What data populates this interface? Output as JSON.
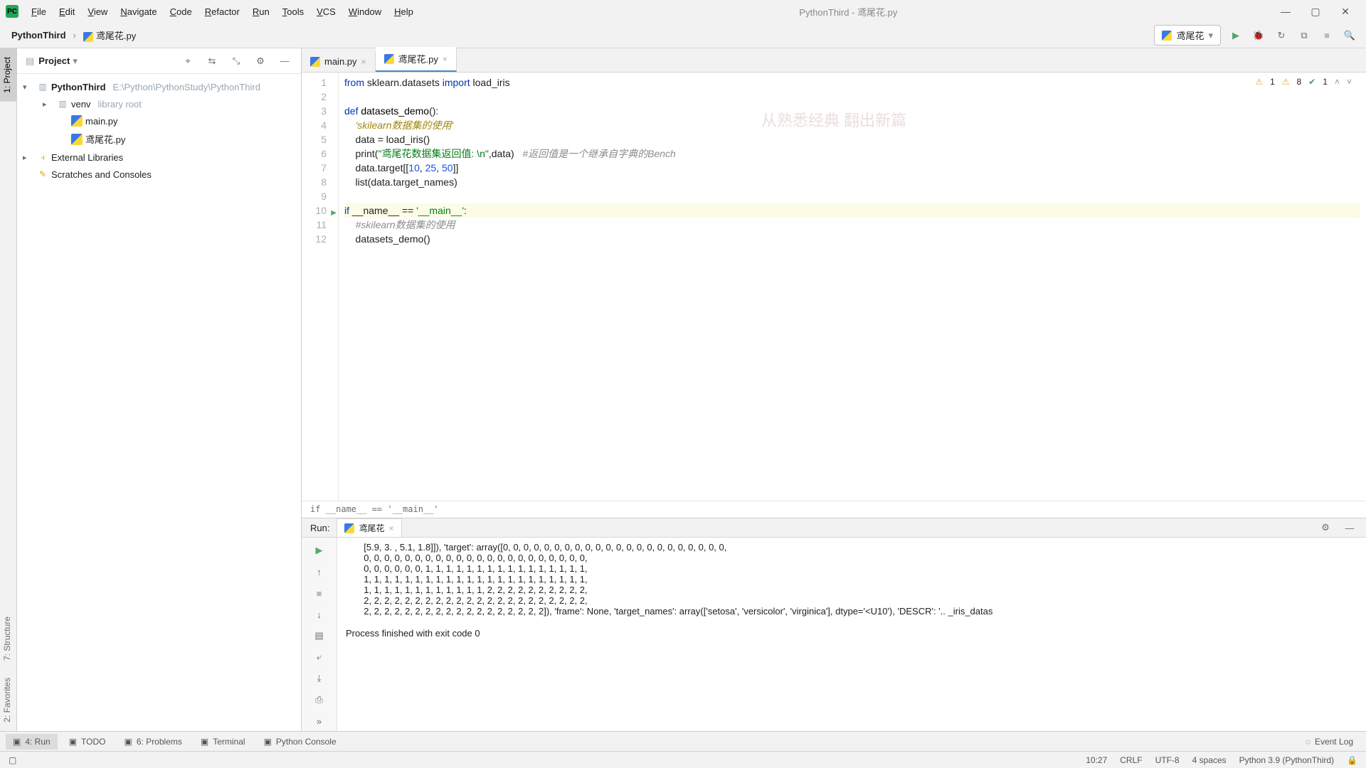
{
  "window": {
    "title": "PythonThird - 鸢尾花.py"
  },
  "menu": [
    "File",
    "Edit",
    "View",
    "Navigate",
    "Code",
    "Refactor",
    "Run",
    "Tools",
    "VCS",
    "Window",
    "Help"
  ],
  "breadcrumb": {
    "project": "PythonThird",
    "file": "鸢尾花.py"
  },
  "run_config": "鸢尾花",
  "project_panel": {
    "title": "Project",
    "root": "PythonThird",
    "root_path": "E:\\Python\\PythonStudy\\PythonThird",
    "venv": "venv",
    "venv_tag": "library root",
    "files": [
      "main.py",
      "鸢尾花.py"
    ],
    "ext_libs": "External Libraries",
    "scratches": "Scratches and Consoles"
  },
  "tabs": [
    {
      "label": "main.py",
      "active": false
    },
    {
      "label": "鸢尾花.py",
      "active": true
    }
  ],
  "inspections": {
    "warning": 1,
    "weak_warning": 8,
    "ok": 1
  },
  "watermark": "从熟悉经典  翻出新篇",
  "code": {
    "lines": [
      {
        "n": 1,
        "html": "<span class='kw'>from</span> sklearn.datasets <span class='kw'>import</span> load_iris"
      },
      {
        "n": 2,
        "html": ""
      },
      {
        "n": 3,
        "html": "<span class='kw'>def</span> <span class='fn'>datasets_demo</span>():"
      },
      {
        "n": 4,
        "html": "    <span class='deco'>'skilearn数据集的使用'</span>"
      },
      {
        "n": 5,
        "html": "    data = load_iris()"
      },
      {
        "n": 6,
        "html": "    print(<span class='str'>\"鸢尾花数据集返回值: \\n\"</span>,data)   <span class='cmt'>#返回值是一个继承自字典的Bench</span>"
      },
      {
        "n": 7,
        "html": "    data.target[[<span class='num'>10</span>, <span class='num'>25</span>, <span class='num'>50</span>]]"
      },
      {
        "n": 8,
        "html": "    list(data.target_names)"
      },
      {
        "n": 9,
        "html": ""
      },
      {
        "n": 10,
        "html": "<span class='kw'>if</span> __name__ == <span class='str'>'__main__'</span>:",
        "hl": true,
        "run": true
      },
      {
        "n": 11,
        "html": "    <span class='cmt'>#skilearn数据集的使用</span>"
      },
      {
        "n": 12,
        "html": "    datasets_demo()"
      }
    ],
    "breadcrumb": "if __name__ == '__main__'"
  },
  "run": {
    "label": "Run:",
    "tab": "鸢尾花",
    "output": [
      "       [5.9, 3. , 5.1, 1.8]]), 'target': array([0, 0, 0, 0, 0, 0, 0, 0, 0, 0, 0, 0, 0, 0, 0, 0, 0, 0, 0, 0, 0, 0,",
      "       0, 0, 0, 0, 0, 0, 0, 0, 0, 0, 0, 0, 0, 0, 0, 0, 0, 0, 0, 0, 0, 0,",
      "       0, 0, 0, 0, 0, 0, 1, 1, 1, 1, 1, 1, 1, 1, 1, 1, 1, 1, 1, 1, 1, 1,",
      "       1, 1, 1, 1, 1, 1, 1, 1, 1, 1, 1, 1, 1, 1, 1, 1, 1, 1, 1, 1, 1, 1,",
      "       1, 1, 1, 1, 1, 1, 1, 1, 1, 1, 1, 1, 2, 2, 2, 2, 2, 2, 2, 2, 2, 2,",
      "       2, 2, 2, 2, 2, 2, 2, 2, 2, 2, 2, 2, 2, 2, 2, 2, 2, 2, 2, 2, 2, 2,",
      "       2, 2, 2, 2, 2, 2, 2, 2, 2, 2, 2, 2, 2, 2, 2, 2, 2, 2]), 'frame': None, 'target_names': array(['setosa', 'versicolor', 'virginica'], dtype='<U10'), 'DESCR': '.. _iris_datas"
    ],
    "exit": "Process finished with exit code 0"
  },
  "bottom_tabs": [
    "4: Run",
    "TODO",
    "6: Problems",
    "Terminal",
    "Python Console"
  ],
  "event_log": "Event Log",
  "status": {
    "pos": "10:27",
    "eol": "CRLF",
    "encoding": "UTF-8",
    "indent": "4 spaces",
    "interpreter": "Python 3.9 (PythonThird)"
  },
  "rail_tabs": [
    "1: Project",
    "7: Structure",
    "2: Favorites"
  ]
}
